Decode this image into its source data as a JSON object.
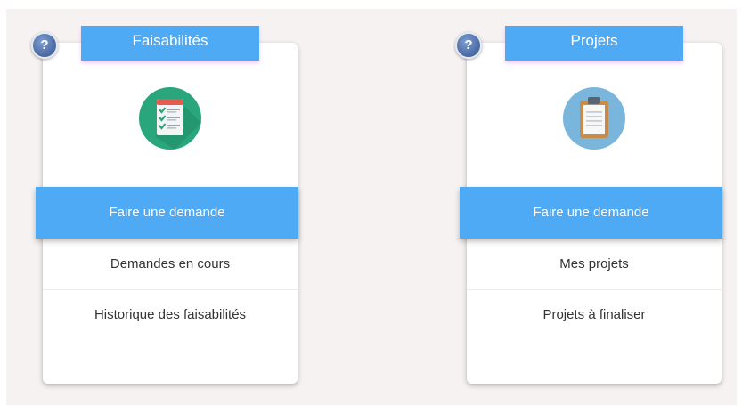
{
  "colors": {
    "accent": "#4eaaf5",
    "background": "#f6f2f2",
    "card": "#ffffff",
    "feasibility_icon_bg": "#2aa67c",
    "projects_icon_bg": "#7ab6dc",
    "help_icon": "#4f6fa8"
  },
  "cards": [
    {
      "help_symbol": "?",
      "title": "Faisabilités",
      "icon": "checklist-icon",
      "primary_action": "Faire une demande",
      "items": [
        "Demandes en cours",
        "Historique des faisabilités"
      ]
    },
    {
      "help_symbol": "?",
      "title": "Projets",
      "icon": "clipboard-icon",
      "primary_action": "Faire une demande",
      "items": [
        "Mes projets",
        "Projets à finaliser"
      ]
    }
  ]
}
